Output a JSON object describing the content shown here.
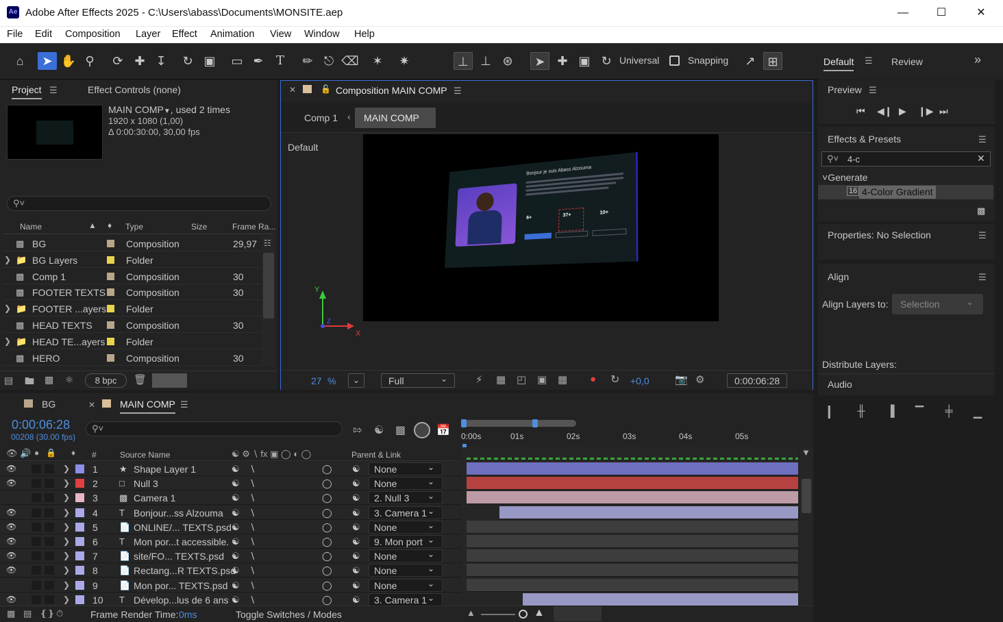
{
  "window": {
    "title": "Adobe After Effects 2025 - C:\\Users\\abass\\Documents\\MONSITE.aep",
    "app_icon": "Ae"
  },
  "menu": [
    "File",
    "Edit",
    "Composition",
    "Layer",
    "Effect",
    "Animation",
    "View",
    "Window",
    "Help"
  ],
  "toolbar": {
    "universal_label": "Universal",
    "snapping_label": "Snapping"
  },
  "workspace": {
    "active": "Default",
    "other": "Review"
  },
  "project": {
    "tab_label": "Project",
    "effect_controls_label": "Effect Controls (none)",
    "selected": {
      "name": "MAIN COMP",
      "used": ", used 2 times",
      "resolution": "1920 x 1080 (1,00)",
      "duration": "Δ 0:00:30:00, 30,00 fps"
    },
    "columns": {
      "name": "Name",
      "type": "Type",
      "size": "Size",
      "frame_rate": "Frame Ra..."
    },
    "items": [
      {
        "name": "BG",
        "type": "Composition",
        "frame_rate": "29,97",
        "folder": false,
        "color": "#b9a58a"
      },
      {
        "name": "BG Layers",
        "type": "Folder",
        "frame_rate": "",
        "folder": true,
        "color": "#e8d34c"
      },
      {
        "name": "Comp 1",
        "type": "Composition",
        "frame_rate": "30",
        "folder": false,
        "color": "#b9a58a"
      },
      {
        "name": "FOOTER TEXTS",
        "type": "Composition",
        "frame_rate": "30",
        "folder": false,
        "color": "#b9a58a"
      },
      {
        "name": "FOOTER ...ayers",
        "type": "Folder",
        "frame_rate": "",
        "folder": true,
        "color": "#e8d34c"
      },
      {
        "name": "HEAD TEXTS",
        "type": "Composition",
        "frame_rate": "30",
        "folder": false,
        "color": "#b9a58a"
      },
      {
        "name": "HEAD TE...ayers",
        "type": "Folder",
        "frame_rate": "",
        "folder": true,
        "color": "#e8d34c"
      },
      {
        "name": "HERO",
        "type": "Composition",
        "frame_rate": "30",
        "folder": false,
        "color": "#b9a58a"
      }
    ],
    "bpc": "8 bpc"
  },
  "composition": {
    "panel_title": "Composition MAIN COMP",
    "breadcrumb_parent": "Comp 1",
    "breadcrumb_current": "MAIN COMP",
    "view_label": "Default",
    "zoom": "27",
    "zoom_unit": "%",
    "resolution": "Full",
    "exposure": "+0,0",
    "timecode": "0:00:06:28",
    "hero_heading": "Bonjour je suis Abass Alzouma",
    "stats": [
      "6+",
      "37+",
      "10+"
    ]
  },
  "preview": {
    "title": "Preview"
  },
  "effects": {
    "title": "Effects & Presets",
    "search": "4-c",
    "category": "Generate",
    "result": "4-Color Gradient"
  },
  "properties": {
    "title": "Properties: No Selection"
  },
  "align": {
    "title": "Align",
    "align_to_label": "Align Layers to:",
    "align_to_value": "Selection",
    "distribute_label": "Distribute Layers:"
  },
  "audio": {
    "title": "Audio"
  },
  "timeline": {
    "tabs": [
      {
        "label": "BG",
        "active": false
      },
      {
        "label": "MAIN COMP",
        "active": true
      }
    ],
    "timecode": "0:00:06:28",
    "frame_info": "00208 (30.00 fps)",
    "columns": {
      "num": "#",
      "source": "Source Name",
      "parent": "Parent & Link"
    },
    "ruler": [
      "0:00s",
      "01s",
      "02s",
      "03s",
      "04s",
      "05s"
    ],
    "layers": [
      {
        "num": "1",
        "name": "Shape Layer 1",
        "parent": "None",
        "label": "#8e8ee8",
        "bar": "#6f6fbf",
        "bar_start": 0.0
      },
      {
        "num": "2",
        "name": "Null 3",
        "parent": "None",
        "label": "#e04040",
        "bar": "#b54141",
        "bar_start": 0.0
      },
      {
        "num": "3",
        "name": "Camera 1",
        "parent": "2. Null 3",
        "label": "#e9b6c4",
        "bar": "#bd9ba6",
        "bar_start": 0.0
      },
      {
        "num": "4",
        "name": "Bonjour...ss Alzouma",
        "parent": "3. Camera 1",
        "label": "#aaaae8",
        "bar": "#9898c5",
        "bar_start": 0.1
      },
      {
        "num": "5",
        "name": "ONLINE/... TEXTS.psd",
        "parent": "None",
        "label": "#aaaae8",
        "bar": "",
        "bar_start": 0.0
      },
      {
        "num": "6",
        "name": "Mon por...t accessible.",
        "parent": "9. Mon port",
        "label": "#aaaae8",
        "bar": "",
        "bar_start": 0.0
      },
      {
        "num": "7",
        "name": "site/FO... TEXTS.psd",
        "parent": "None",
        "label": "#aaaae8",
        "bar": "",
        "bar_start": 0.0
      },
      {
        "num": "8",
        "name": "Rectang...R TEXTS.psd",
        "parent": "None",
        "label": "#aaaae8",
        "bar": "",
        "bar_start": 0.0
      },
      {
        "num": "9",
        "name": "Mon por... TEXTS.psd",
        "parent": "None",
        "label": "#aaaae8",
        "bar": "",
        "bar_start": 0.0
      },
      {
        "num": "10",
        "name": "Dévelop...lus de 6 ans",
        "parent": "3. Camera 1",
        "label": "#aaaae8",
        "bar": "#9898c5",
        "bar_start": 0.17
      }
    ],
    "render_time_label": "Frame Render Time:",
    "render_time_value": "0ms",
    "toggle_label": "Toggle Switches / Modes"
  }
}
